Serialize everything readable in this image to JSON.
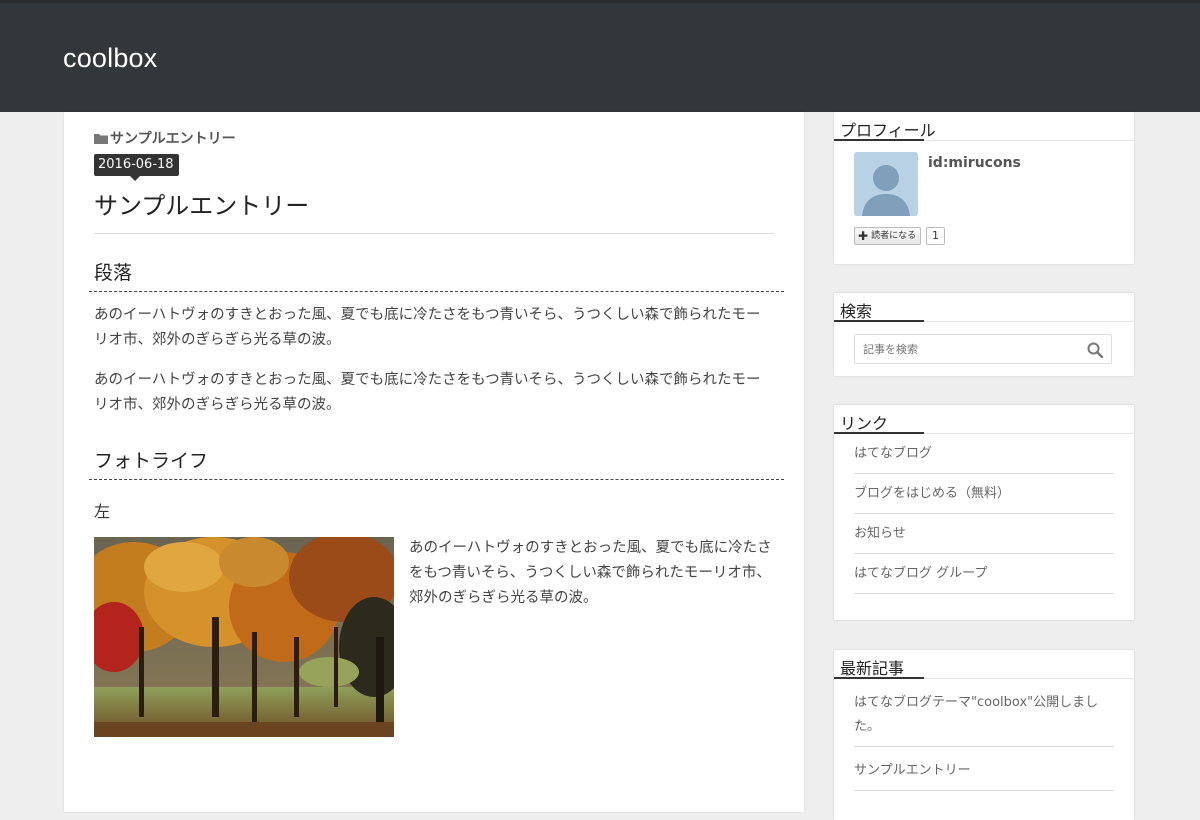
{
  "header": {
    "site_title": "coolbox"
  },
  "entry": {
    "category": "サンプルエントリー",
    "date": "2016-06-18",
    "title": "サンプルエントリー",
    "section1_heading": "段落",
    "paragraph1": "あのイーハトヴォのすきとおった風、夏でも底に冷たさをもつ青いそら、うつくしい森で飾られたモーリオ市、郊外のぎらぎら光る草の波。",
    "paragraph2": "あのイーハトヴォのすきとおった風、夏でも底に冷たさをもつ青いそら、うつくしい森で飾られたモーリオ市、郊外のぎらぎら光る草の波。",
    "section2_heading": "フォトライフ",
    "subsection_heading": "左",
    "photo_text": "あのイーハトヴォのすきとおった風、夏でも底に冷たさをもつ青いそら、うつくしい森で飾られたモーリオ市、郊外のぎらぎら光る草の波。"
  },
  "sidebar": {
    "profile": {
      "title": "プロフィール",
      "id": "id:mirucons",
      "subscribe_label": "読者になる",
      "subscriber_count": "1"
    },
    "search": {
      "title": "検索",
      "placeholder": "記事を検索"
    },
    "links": {
      "title": "リンク",
      "items": [
        "はてなブログ",
        "ブログをはじめる（無料）",
        "お知らせ",
        "はてなブログ グループ"
      ]
    },
    "recent": {
      "title": "最新記事",
      "items": [
        "はてなブログテーマ\"coolbox\"公開しました。",
        "サンプルエントリー"
      ]
    }
  }
}
